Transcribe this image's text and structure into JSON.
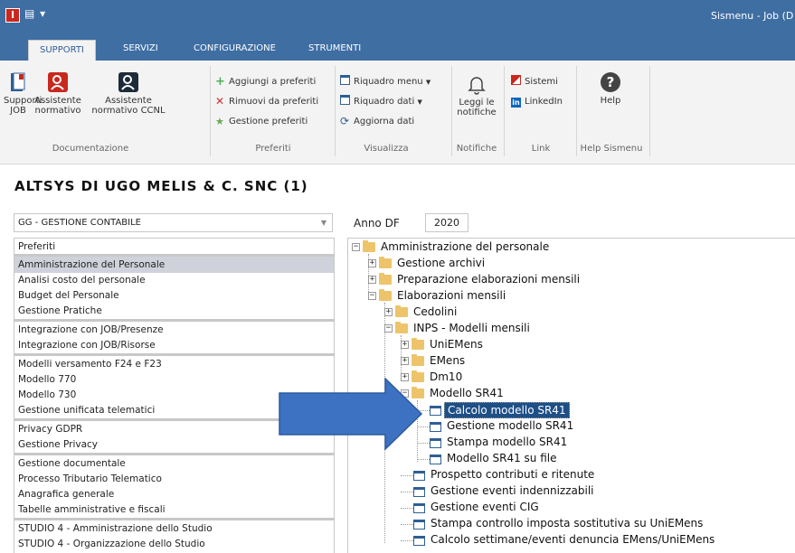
{
  "window": {
    "app_icon": "I",
    "qat": "▤ ▾",
    "title": "Sismenu - Job  (D"
  },
  "tabs": [
    "SUPPORTI",
    "SERVIZI",
    "CONFIGURAZIONE",
    "STRUMENTI"
  ],
  "ribbon": {
    "documentazione": {
      "label": "Documentazione",
      "supporti_job": [
        "Supporti",
        "JOB"
      ],
      "assistente_normativo": [
        "Assistente",
        "normativo"
      ],
      "assistente_ccnl": [
        "Assistente",
        "normativo CCNL"
      ]
    },
    "preferiti": {
      "label": "Preferiti",
      "aggiungi": "Aggiungi a preferiti",
      "rimuovi": "Rimuovi da preferiti",
      "gestione": "Gestione preferiti"
    },
    "visualizza": {
      "label": "Visualizza",
      "riquadro_menu": "Riquadro menu",
      "riquadro_dati": "Riquadro dati",
      "aggiorna": "Aggiorna dati"
    },
    "notifiche": {
      "label": "Notifiche",
      "leggi": [
        "Leggi le",
        "notifiche"
      ]
    },
    "link": {
      "label": "Link",
      "sistemi": "Sistemi",
      "linkedin": "LinkedIn"
    },
    "help": {
      "label": "Help Sismenu",
      "help": "Help"
    }
  },
  "company": "ALTSYS DI UGO MELIS & C. SNC (1)",
  "module_select": "GG - GESTIONE CONTABILE",
  "anno": {
    "label": "Anno DF",
    "value": "2020"
  },
  "menu_list": [
    "Preferiti",
    "Amministrazione del Personale",
    "Analisi costo del personale",
    "Budget del Personale",
    "Gestione Pratiche",
    "Integrazione con JOB/Presenze",
    "Integrazione con JOB/Risorse",
    "Modelli versamento F24 e F23",
    "Modello 770",
    "Modello 730",
    "Gestione unificata telematici",
    "Privacy GDPR",
    "Gestione Privacy",
    "Gestione documentale",
    "Processo Tributario Telematico",
    "Anagrafica generale",
    "Tabelle amministrative e fiscali",
    "STUDIO 4 - Amministrazione dello Studio",
    "STUDIO 4 - Organizzazione dello Studio"
  ],
  "tree": [
    "Amministrazione del personale",
    "Gestione archivi",
    "Preparazione elaborazioni mensili",
    "Elaborazioni mensili",
    "Cedolini",
    "INPS - Modelli mensili",
    "UniEMens",
    "EMens",
    "Dm10",
    "Modello SR41",
    "Calcolo modello SR41",
    "Gestione modello SR41",
    "Stampa modello SR41",
    "Modello SR41 su file",
    "Prospetto contributi e ritenute",
    "Gestione eventi indennizzabili",
    "Gestione eventi CIG",
    "Stampa controllo imposta sostitutiva su UniEMens",
    "Calcolo settimane/eventi denuncia EMens/UniEMens"
  ],
  "colors": {
    "titlebar": "#3f6ea3",
    "selected_tree": "#1e4f86",
    "arrow": "#3d72c2",
    "folder": "#eec46a"
  }
}
